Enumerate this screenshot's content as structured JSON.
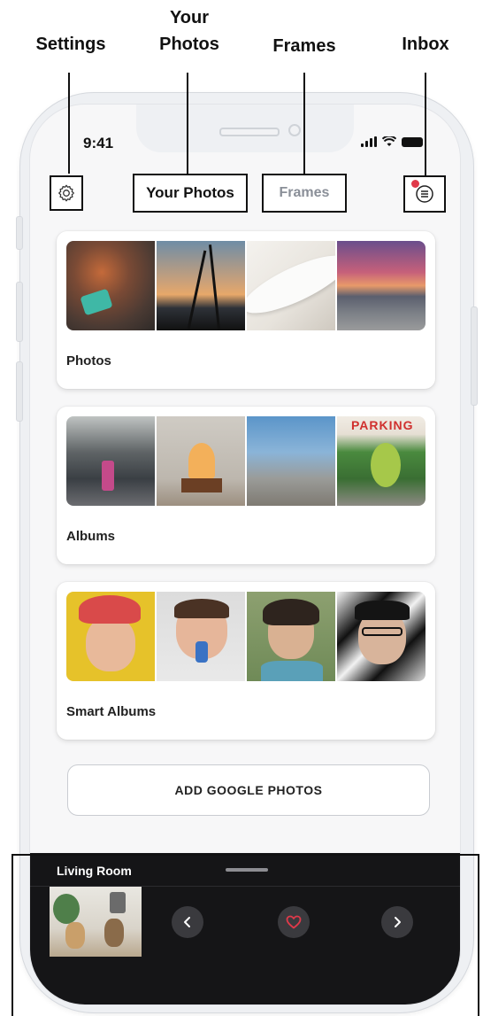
{
  "annotations": {
    "settings": "Settings",
    "your_photos_line1": "Your",
    "your_photos_line2": "Photos",
    "frames": "Frames",
    "inbox": "Inbox"
  },
  "status_bar": {
    "time": "9:41"
  },
  "header": {
    "settings_icon": "gear-icon",
    "tab_active": "Your Photos",
    "tab_inactive": "Frames",
    "inbox_icon": "inbox-icon",
    "inbox_badge_color": "#e0394a"
  },
  "cards": [
    {
      "label": "Photos"
    },
    {
      "label": "Albums",
      "parking_sign": "PARKING"
    },
    {
      "label": "Smart Albums"
    }
  ],
  "add_button": {
    "label": "ADD GOOGLE PHOTOS"
  },
  "player": {
    "title": "Living Room",
    "prev_icon": "chevron-left-icon",
    "heart_icon": "heart-icon",
    "next_icon": "chevron-right-icon",
    "heart_color": "#e0394a"
  }
}
